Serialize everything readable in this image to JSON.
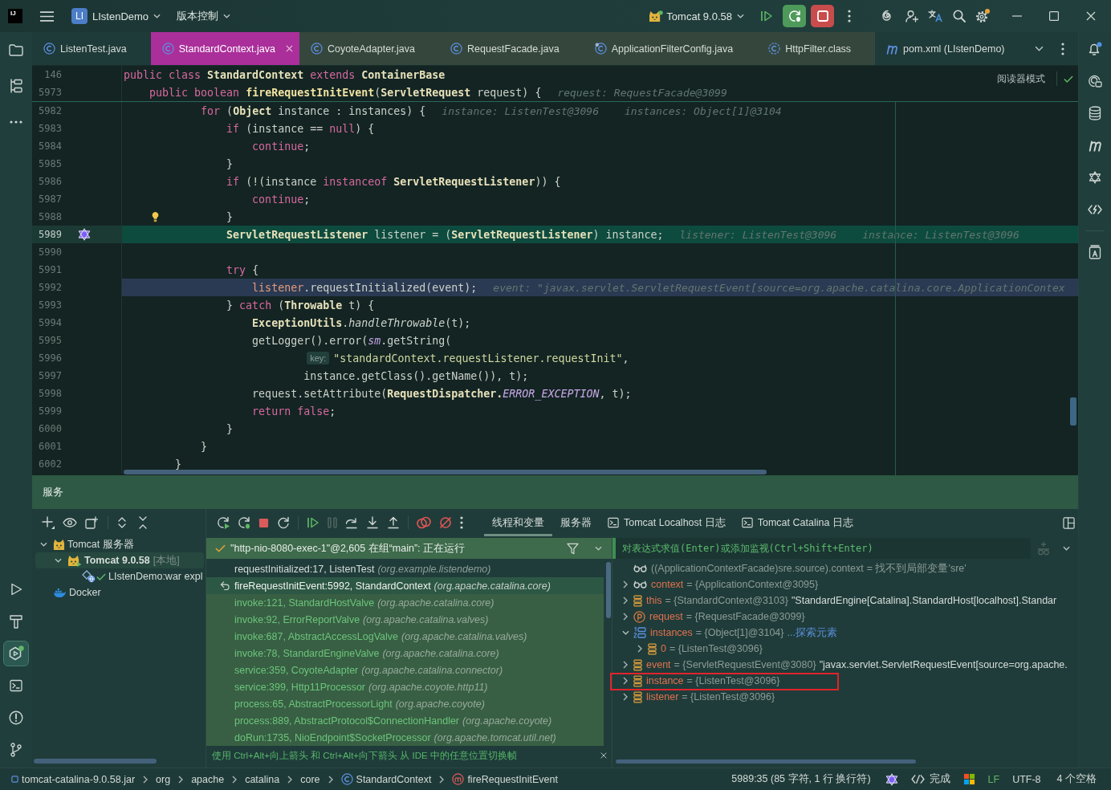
{
  "title_bar": {
    "logo": "IJ",
    "project_badge": "LI",
    "project": "LIstenDemo",
    "vcs_menu": "版本控制",
    "run_config": "Tomcat 9.0.58"
  },
  "tool_strips": {
    "left_top": [
      {
        "kind": "project",
        "selected": false
      },
      {
        "kind": "structure",
        "selected": false
      },
      {
        "kind": "more",
        "selected": false
      }
    ],
    "left_bottom": [
      {
        "kind": "run",
        "selected": false
      },
      {
        "kind": "build",
        "selected": false
      },
      {
        "kind": "services",
        "selected": true
      },
      {
        "kind": "terminal",
        "selected": false
      },
      {
        "kind": "problems",
        "selected": false
      },
      {
        "kind": "git",
        "selected": false
      }
    ],
    "right_top": [
      {
        "kind": "notifications",
        "selected": false
      },
      {
        "kind": "ai_assistant",
        "selected": false
      },
      {
        "kind": "database",
        "selected": false
      },
      {
        "kind": "maven",
        "selected": false
      },
      {
        "kind": "plugin",
        "selected": false
      },
      {
        "kind": "endpoints",
        "selected": false
      }
    ],
    "right_bottom": [
      {
        "kind": "reader",
        "selected": false
      }
    ]
  },
  "editor_tabs": [
    {
      "label": "ListenTest.java",
      "kind": "class",
      "library": false,
      "selected": false
    },
    {
      "label": "StandardContext.java",
      "kind": "class",
      "library": true,
      "selected": true
    },
    {
      "label": "CoyoteAdapter.java",
      "kind": "class",
      "library": true,
      "selected": false
    },
    {
      "label": "RequestFacade.java",
      "kind": "class",
      "library": true,
      "selected": false
    },
    {
      "label": "ApplicationFilterConfig.java",
      "kind": "final_class",
      "library": true,
      "selected": false
    },
    {
      "label": "HttpFilter.class",
      "kind": "abstract_class",
      "library": true,
      "selected": false
    },
    {
      "label": "pom.xml (LIstenDemo)",
      "kind": "maven",
      "library": false,
      "selected": false
    }
  ],
  "editor": {
    "reader_mode": "阅读器模式",
    "sticky_lines": [
      {
        "number": "146",
        "code": [
          {
            "kind": "kw",
            "text": "public class "
          },
          {
            "kind": "type",
            "text": "StandardContext"
          },
          {
            "kind": "kw",
            "text": " extends "
          },
          {
            "kind": "type",
            "text": "ContainerBase"
          }
        ]
      },
      {
        "number": "5973",
        "code": [
          {
            "kind": "kw",
            "text": "    public boolean "
          },
          {
            "kind": "decl",
            "text": "fireRequestInitEvent"
          },
          {
            "kind": "plain",
            "text": "("
          },
          {
            "kind": "type",
            "text": "ServletRequest"
          },
          {
            "kind": "plain",
            "text": " request) {"
          }
        ],
        "hints": [
          "request: RequestFacade@3099"
        ]
      }
    ],
    "lines": [
      {
        "number": "5982",
        "kind": "plain",
        "caret_line": false,
        "execution_point": false,
        "code": [
          {
            "kind": "kw",
            "text": "            for "
          },
          {
            "kind": "plain",
            "text": "("
          },
          {
            "kind": "type",
            "text": "Object"
          },
          {
            "kind": "plain",
            "text": " instance : instances) {"
          }
        ],
        "hints": [
          "instance: ListenTest@3096",
          "instances: Object[1]@3104"
        ]
      },
      {
        "number": "5983",
        "kind": "plain",
        "caret_line": false,
        "execution_point": false,
        "code": [
          {
            "kind": "kw",
            "text": "                if "
          },
          {
            "kind": "plain",
            "text": "(instance == "
          },
          {
            "kind": "kw",
            "text": "null"
          },
          {
            "kind": "plain",
            "text": ") {"
          }
        ]
      },
      {
        "number": "5984",
        "kind": "plain",
        "caret_line": false,
        "execution_point": false,
        "code": [
          {
            "kind": "kw",
            "text": "                    continue"
          },
          {
            "kind": "plain",
            "text": ";"
          }
        ]
      },
      {
        "number": "5985",
        "kind": "plain",
        "caret_line": false,
        "execution_point": false,
        "code": [
          {
            "kind": "plain",
            "text": "                }"
          }
        ]
      },
      {
        "number": "5986",
        "kind": "plain",
        "caret_line": false,
        "execution_point": false,
        "code": [
          {
            "kind": "kw",
            "text": "                if "
          },
          {
            "kind": "plain",
            "text": "(!(instance "
          },
          {
            "kind": "kw",
            "text": "instanceof "
          },
          {
            "kind": "type",
            "text": "ServletRequestListener"
          },
          {
            "kind": "plain",
            "text": ")) {"
          }
        ]
      },
      {
        "number": "5987",
        "kind": "plain",
        "caret_line": false,
        "execution_point": false,
        "code": [
          {
            "kind": "kw",
            "text": "                    continue"
          },
          {
            "kind": "plain",
            "text": ";"
          }
        ]
      },
      {
        "number": "5988",
        "kind": "bulb",
        "caret_line": false,
        "execution_point": false,
        "code": [
          {
            "kind": "plain",
            "text": "                }"
          }
        ]
      },
      {
        "number": "5989",
        "kind": "plugin",
        "caret_line": true,
        "execution_point": false,
        "code": [
          {
            "kind": "type",
            "text": "                ServletRequestListener"
          },
          {
            "kind": "plain",
            "text": " listener = ("
          },
          {
            "kind": "type",
            "text": "ServletRequestListener"
          },
          {
            "kind": "plain",
            "text": ") instance;"
          }
        ],
        "hints": [
          "listener: ListenTest@3096",
          "instance: ListenTest@3096"
        ]
      },
      {
        "number": "5990",
        "kind": "plain",
        "caret_line": false,
        "execution_point": false
      },
      {
        "number": "5991",
        "kind": "plain",
        "caret_line": false,
        "execution_point": false,
        "code": [
          {
            "kind": "kw",
            "text": "                try "
          },
          {
            "kind": "plain",
            "text": "{"
          }
        ]
      },
      {
        "number": "5992",
        "kind": "plain",
        "caret_line": false,
        "execution_point": true,
        "code": [
          {
            "kind": "var",
            "text": "                    listener"
          },
          {
            "kind": "plain",
            "text": ".requestInitialized(event);"
          }
        ],
        "hints": [
          "event: \"javax.servlet.ServletRequestEvent[source=org.apache.catalina.core.ApplicationContex"
        ]
      },
      {
        "number": "5993",
        "kind": "plain",
        "caret_line": false,
        "execution_point": false,
        "code": [
          {
            "kind": "plain",
            "text": "                } "
          },
          {
            "kind": "kw",
            "text": "catch "
          },
          {
            "kind": "plain",
            "text": "("
          },
          {
            "kind": "type",
            "text": "Throwable"
          },
          {
            "kind": "plain",
            "text": " t) {"
          }
        ]
      },
      {
        "number": "5994",
        "kind": "plain",
        "caret_line": false,
        "execution_point": false,
        "code": [
          {
            "kind": "type",
            "text": "                    ExceptionUtils"
          },
          {
            "kind": "plain",
            "text": "."
          },
          {
            "kind": "static",
            "text": "handleThrowable"
          },
          {
            "kind": "plain",
            "text": "(t);"
          }
        ]
      },
      {
        "number": "5995",
        "kind": "plain",
        "caret_line": false,
        "execution_point": false,
        "code": [
          {
            "kind": "plain",
            "text": "                    getLogger().error("
          },
          {
            "kind": "field",
            "text": "sm"
          },
          {
            "kind": "plain",
            "text": ".getString("
          }
        ]
      },
      {
        "number": "5996",
        "kind": "plain",
        "caret_line": false,
        "execution_point": false,
        "param_hint": "key:",
        "code": [
          {
            "kind": "string",
            "text": "                            \"standardContext.requestListener.requestInit\""
          },
          {
            "kind": "plain",
            "text": ","
          }
        ]
      },
      {
        "number": "5997",
        "kind": "plain",
        "caret_line": false,
        "execution_point": false,
        "code": [
          {
            "kind": "plain",
            "text": "                            instance.getClass().getName()), t);"
          }
        ]
      },
      {
        "number": "5998",
        "kind": "plain",
        "caret_line": false,
        "execution_point": false,
        "code": [
          {
            "kind": "plain",
            "text": "                    request.setAttribute("
          },
          {
            "kind": "type",
            "text": "RequestDispatcher."
          },
          {
            "kind": "const",
            "text": "ERROR_EXCEPTION"
          },
          {
            "kind": "plain",
            "text": ", t);"
          }
        ]
      },
      {
        "number": "5999",
        "kind": "plain",
        "caret_line": false,
        "execution_point": false,
        "code": [
          {
            "kind": "kw",
            "text": "                    return false"
          },
          {
            "kind": "plain",
            "text": ";"
          }
        ]
      },
      {
        "number": "6000",
        "kind": "plain",
        "caret_line": false,
        "execution_point": false,
        "code": [
          {
            "kind": "plain",
            "text": "                }"
          }
        ]
      },
      {
        "number": "6001",
        "kind": "plain",
        "caret_line": false,
        "execution_point": false,
        "code": [
          {
            "kind": "plain",
            "text": "            }"
          }
        ]
      },
      {
        "number": "6002",
        "kind": "plain",
        "caret_line": false,
        "execution_point": false,
        "code": [
          {
            "kind": "plain",
            "text": "        }"
          }
        ]
      }
    ]
  },
  "services": {
    "title": "服务",
    "tree": [
      {
        "label": "Tomcat 服务器",
        "kind": "tomcat_group",
        "expanded": true,
        "selected": false,
        "children": [
          {
            "label": "Tomcat 9.0.58",
            "tag": "[本地]",
            "kind": "server",
            "expanded": true,
            "selected": true,
            "children": [
              {
                "label": "LIstenDemo:war expl",
                "kind": "artifact",
                "deployed": true,
                "selected": false
              }
            ]
          }
        ]
      },
      {
        "label": "Docker",
        "kind": "docker",
        "selected": false
      }
    ],
    "tabs": [
      {
        "label": "线程和变量",
        "kind": "plain",
        "selected": true
      },
      {
        "label": "服务器",
        "kind": "plain",
        "selected": false
      },
      {
        "label": "Tomcat Localhost 日志",
        "kind": "log",
        "selected": false
      },
      {
        "label": "Tomcat Catalina 日志",
        "kind": "log",
        "selected": false
      }
    ],
    "thread": "\"http-nio-8080-exec-1\"@2,605 在组“main”: 正在运行",
    "frames": [
      {
        "method": "requestInitialized:17, ListenTest",
        "package": "(org.example.listendemo)",
        "kind": "project",
        "selected": false
      },
      {
        "method": "fireRequestInitEvent:5992, StandardContext",
        "package": "(org.apache.catalina.core)",
        "kind": "library",
        "selected": true
      },
      {
        "method": "invoke:121, StandardHostValve",
        "package": "(org.apache.catalina.core)",
        "kind": "library",
        "selected": false
      },
      {
        "method": "invoke:92, ErrorReportValve",
        "package": "(org.apache.catalina.valves)",
        "kind": "library",
        "selected": false
      },
      {
        "method": "invoke:687, AbstractAccessLogValve",
        "package": "(org.apache.catalina.valves)",
        "kind": "library",
        "selected": false
      },
      {
        "method": "invoke:78, StandardEngineValve",
        "package": "(org.apache.catalina.core)",
        "kind": "library",
        "selected": false
      },
      {
        "method": "service:359, CoyoteAdapter",
        "package": "(org.apache.catalina.connector)",
        "kind": "library",
        "selected": false
      },
      {
        "method": "service:399, Http11Processor",
        "package": "(org.apache.coyote.http11)",
        "kind": "library",
        "selected": false
      },
      {
        "method": "process:65, AbstractProcessorLight",
        "package": "(org.apache.coyote)",
        "kind": "library",
        "selected": false
      },
      {
        "method": "process:889, AbstractProtocol$ConnectionHandler",
        "package": "(org.apache.coyote)",
        "kind": "library",
        "selected": false
      },
      {
        "method": "doRun:1735, NioEndpoint$SocketProcessor",
        "package": "(org.apache.tomcat.util.net)",
        "kind": "library",
        "selected": false
      }
    ],
    "frames_hint": "使用 Ctrl+Alt+向上箭头 和 Ctrl+Alt+向下箭头 从 IDE 中的任意位置切换帧",
    "expression_placeholder": "对表达式求值(Enter)或添加监视(Ctrl+Shift+Enter)",
    "variables": [
      {
        "kind": "watch_error",
        "name": "((ApplicationContextFacade)sre.source).context",
        "value": "= 找不到局部变量'sre'",
        "annotated": false
      },
      {
        "kind": "watch",
        "name": "context",
        "value": "= {ApplicationContext@3095}",
        "expanded": false,
        "annotated": false
      },
      {
        "kind": "object",
        "name": "this",
        "value": "= {StandardContext@3103}",
        "detail": "\"StandardEngine[Catalina].StandardHost[localhost].Standar",
        "expanded": false,
        "annotated": false
      },
      {
        "kind": "parameter",
        "name": "request",
        "value": "= {RequestFacade@3099}",
        "expanded": false,
        "annotated": false
      },
      {
        "kind": "array",
        "name": "instances",
        "value": "= {Object[1]@3104}",
        "link": "...探索元素",
        "expanded": true,
        "annotated": false,
        "children": [
          {
            "kind": "object",
            "name": "0",
            "value": "= {ListenTest@3096}",
            "expanded": false,
            "annotated": false
          }
        ]
      },
      {
        "kind": "object",
        "name": "event",
        "value": "= {ServletRequestEvent@3080}",
        "detail": "\"javax.servlet.ServletRequestEvent[source=org.apache.",
        "expanded": false,
        "annotated": false
      },
      {
        "kind": "object",
        "name": "instance",
        "value": "= {ListenTest@3096}",
        "expanded": false,
        "annotated": true
      },
      {
        "kind": "object",
        "name": "listener",
        "value": "= {ListenTest@3096}",
        "expanded": false,
        "annotated": false
      }
    ]
  },
  "status_bar": {
    "breadcrumbs": [
      {
        "label": "tomcat-catalina-9.0.58.jar",
        "kind": "jar"
      },
      {
        "label": "org",
        "kind": "package"
      },
      {
        "label": "apache",
        "kind": "package"
      },
      {
        "label": "catalina",
        "kind": "package"
      },
      {
        "label": "core",
        "kind": "package"
      },
      {
        "label": "StandardContext",
        "kind": "class"
      },
      {
        "label": "fireRequestInitEvent",
        "kind": "method"
      }
    ],
    "position": "5989:35 (85 字符, 1 行 换行符)",
    "ai_status": "完成",
    "line_separator": "LF",
    "encoding": "UTF-8",
    "indent": "4 个空格"
  }
}
